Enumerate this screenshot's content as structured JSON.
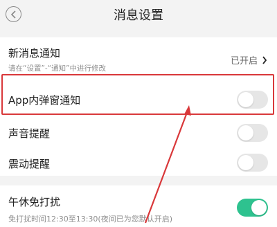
{
  "header": {
    "title": "消息设置",
    "back_icon": "back-arrow-icon"
  },
  "settings": {
    "new_message": {
      "label": "新消息通知",
      "hint": "请在“设置”-“通知”中进行修改",
      "status": "已开启",
      "icon": "chevron-right-icon"
    },
    "in_app_popup": {
      "label": "App内弹窗通知",
      "enabled": false
    },
    "sound": {
      "label": "声音提醒",
      "enabled": false
    },
    "vibration": {
      "label": "震动提醒",
      "enabled": false
    },
    "nap_dnd": {
      "label": "午休免打扰",
      "hint": "免打扰时间12:30至13:30(夜间已为您默认开启)",
      "enabled": true
    }
  },
  "colors": {
    "toggle_on": "#2ec28f",
    "toggle_off": "#e6e6e6",
    "annotation_red": "#d9383a"
  }
}
